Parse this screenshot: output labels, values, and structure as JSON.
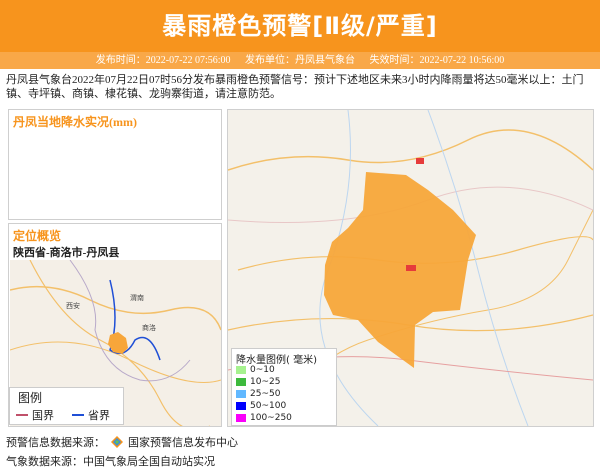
{
  "header": {
    "title": "暴雨橙色预警[Ⅱ级/严重]",
    "publish_time": "发布时间：2022-07-22 07:56:00",
    "publisher": "发布单位：丹凤县气象台",
    "expire_time": "失效时间：2022-07-22 10:56:00"
  },
  "description": "丹凤县气象台2022年07月22日07时56分发布暴雨橙色预警信号：预计下述地区未来3小时内降雨量将达50毫米以上：土门镇、寺坪镇、商镇、棣花镇、龙驹寨街道，请注意防范。",
  "precip_panel": {
    "title": "丹凤当地降水实况(mm)"
  },
  "location_panel": {
    "title": "定位概览",
    "region": "陕西省-商洛市-丹凤县",
    "map_labels": [
      "西安",
      "渭南",
      "商洛"
    ],
    "legend_title": "图例",
    "legend_items": [
      {
        "label": "国界",
        "color": "#c0506a"
      },
      {
        "label": "省界",
        "color": "#1f4fd6"
      }
    ]
  },
  "rain_legend": {
    "title": "降水量图例( 毫米)",
    "items": [
      {
        "label": "0~10",
        "color": "#a6f28f"
      },
      {
        "label": "10~25",
        "color": "#3dba3d"
      },
      {
        "label": "25~50",
        "color": "#61b8ff"
      },
      {
        "label": "50~100",
        "color": "#0000fe"
      },
      {
        "label": "100~250",
        "color": "#fa00fa"
      }
    ]
  },
  "footer": {
    "warning_source_label": "预警信息数据来源：",
    "warning_source": "国家预警信息发布中心",
    "weather_source": "气象数据来源：中国气象局全国自动站实况"
  },
  "colors": {
    "accent": "#f7941d",
    "warning_area": "#f7a63a"
  },
  "icons": [
    "source-logo-icon"
  ]
}
